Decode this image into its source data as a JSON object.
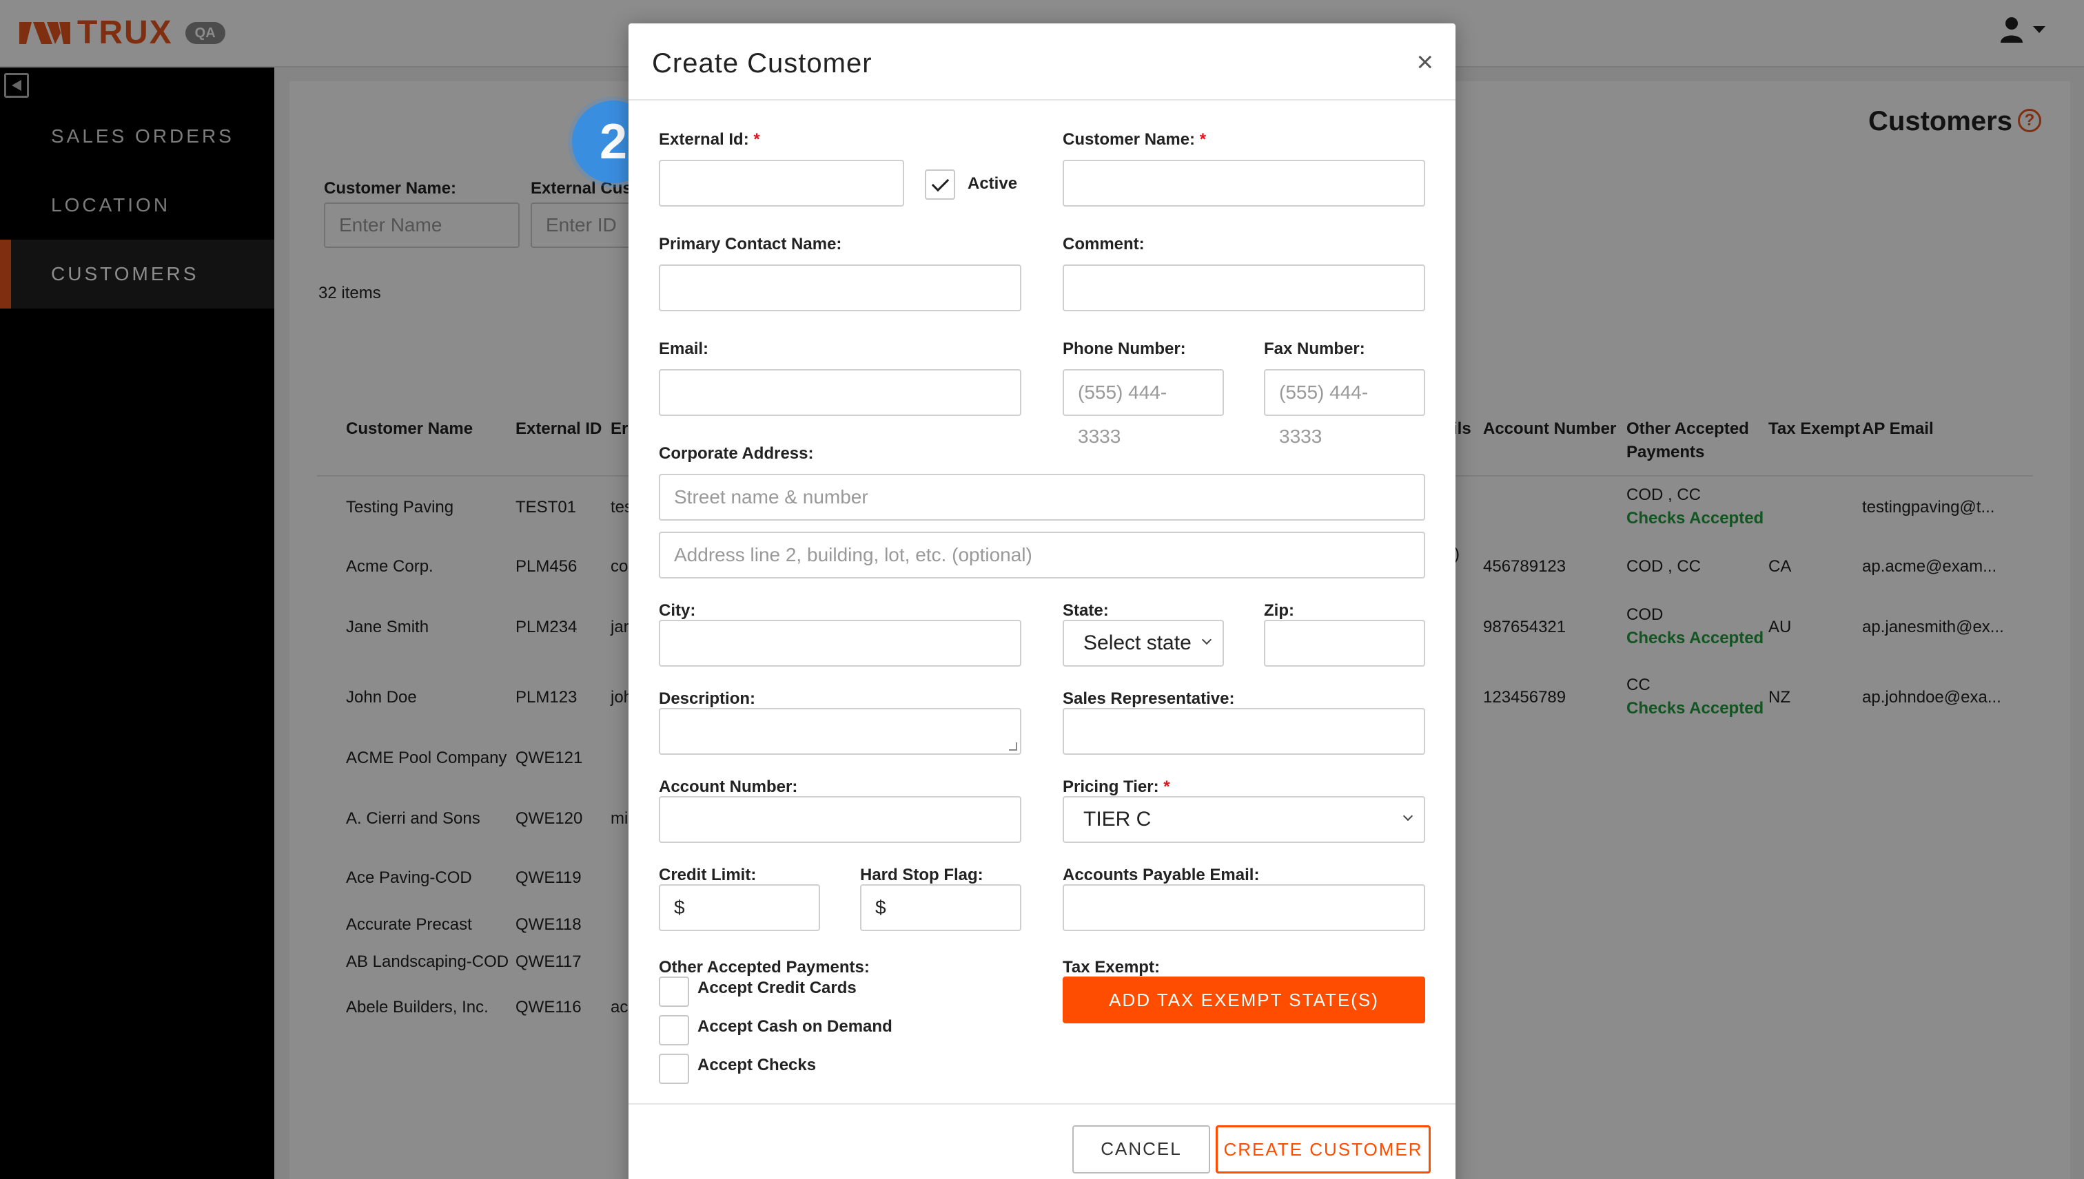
{
  "app": {
    "brand": "TRUX",
    "env_badge": "QA"
  },
  "sidebar": {
    "items": [
      {
        "label": "SALES ORDERS"
      },
      {
        "label": "LOCATION"
      },
      {
        "label": "CUSTOMERS"
      }
    ]
  },
  "page": {
    "title": "Customers",
    "help": "?",
    "filters": {
      "customer_name_label": "Customer Name:",
      "customer_name_placeholder": "Enter Name",
      "external_id_label": "External Cus",
      "external_id_placeholder": "Enter ID"
    },
    "items_count": "32 items"
  },
  "table": {
    "left_headers": [
      "Customer Name",
      "External ID",
      "Er"
    ],
    "right_headers": [
      "ils",
      "Account Number",
      "Other Accepted Payments",
      "Tax Exempt",
      "AP Email"
    ],
    "rows": [
      {
        "name": "Testing Paving",
        "ext_id": "TEST01",
        "em": "tes",
        "ils": "",
        "account": "",
        "payments": "COD , CC",
        "checks": "Checks Accepted",
        "tax": "",
        "ap_email": "testingpaving@t..."
      },
      {
        "name": "Acme Corp.",
        "ext_id": "PLM456",
        "em": "co",
        "ils": ")",
        "account": "456789123",
        "payments": "COD , CC",
        "checks": "",
        "tax": "CA",
        "ap_email": "ap.acme@exam..."
      },
      {
        "name": "Jane Smith",
        "ext_id": "PLM234",
        "em": "jar",
        "ils": "",
        "account": "987654321",
        "payments": "COD",
        "checks": "Checks Accepted",
        "tax": "AU",
        "ap_email": "ap.janesmith@ex..."
      },
      {
        "name": "John Doe",
        "ext_id": "PLM123",
        "em": "joh",
        "ils": "",
        "account": "123456789",
        "payments": "CC",
        "checks": "Checks Accepted",
        "tax": "NZ",
        "ap_email": "ap.johndoe@exa..."
      },
      {
        "name": "ACME Pool Company",
        "ext_id": "QWE121",
        "em": "",
        "ils": "",
        "account": "",
        "payments": "",
        "checks": "",
        "tax": "",
        "ap_email": ""
      },
      {
        "name": "A. Cierri and Sons",
        "ext_id": "QWE120",
        "em": "mi",
        "ils": "",
        "account": "",
        "payments": "",
        "checks": "",
        "tax": "",
        "ap_email": ""
      },
      {
        "name": "Ace Paving-COD",
        "ext_id": "QWE119",
        "em": "",
        "ils": "",
        "account": "",
        "payments": "",
        "checks": "",
        "tax": "",
        "ap_email": ""
      },
      {
        "name": "Accurate Precast",
        "ext_id": "QWE118",
        "em": "",
        "ils": "",
        "account": "",
        "payments": "",
        "checks": "",
        "tax": "",
        "ap_email": ""
      },
      {
        "name": "AB Landscaping-COD",
        "ext_id": "QWE117",
        "em": "",
        "ils": "",
        "account": "",
        "payments": "",
        "checks": "",
        "tax": "",
        "ap_email": ""
      },
      {
        "name": "Abele Builders, Inc.",
        "ext_id": "QWE116",
        "em": "ac",
        "ils": "",
        "account": "",
        "payments": "",
        "checks": "",
        "tax": "",
        "ap_email": ""
      }
    ]
  },
  "modal": {
    "title": "Create Customer",
    "close": "×",
    "step_badge": "2",
    "external_id_label": "External Id:",
    "active_label": "Active",
    "active_checked": true,
    "customer_name_label": "Customer Name:",
    "primary_contact_label": "Primary Contact Name:",
    "comment_label": "Comment:",
    "email_label": "Email:",
    "phone_label": "Phone Number:",
    "phone_placeholder": "(555) 444-3333",
    "fax_label": "Fax Number:",
    "fax_placeholder": "(555) 444-3333",
    "corp_address_label": "Corporate Address:",
    "street_placeholder": "Street name & number",
    "address2_placeholder": "Address line 2, building, lot, etc. (optional)",
    "city_label": "City:",
    "state_label": "State:",
    "state_value": "Select state",
    "zip_label": "Zip:",
    "description_label": "Description:",
    "sales_rep_label": "Sales Representative:",
    "account_number_label": "Account Number:",
    "pricing_tier_label": "Pricing Tier:",
    "pricing_tier_value": "TIER C",
    "credit_limit_label": "Credit Limit:",
    "hard_stop_label": "Hard Stop Flag:",
    "currency_symbol": "$",
    "ap_email_label": "Accounts Payable Email:",
    "other_payments_label": "Other Accepted Payments:",
    "payment_options": [
      "Accept Credit Cards",
      "Accept Cash on Demand",
      "Accept Checks"
    ],
    "tax_exempt_label": "Tax Exempt:",
    "add_tax_exempt_label": "ADD TAX EXEMPT STATE(S)",
    "cancel_label": "CANCEL",
    "create_label": "CREATE CUSTOMER",
    "required_mark": "*"
  },
  "colors": {
    "brand": "#e8571d",
    "primary_button": "#ff4d00",
    "accent_badge": "#3a8ee0",
    "checks_accepted": "#1f9d3b"
  }
}
